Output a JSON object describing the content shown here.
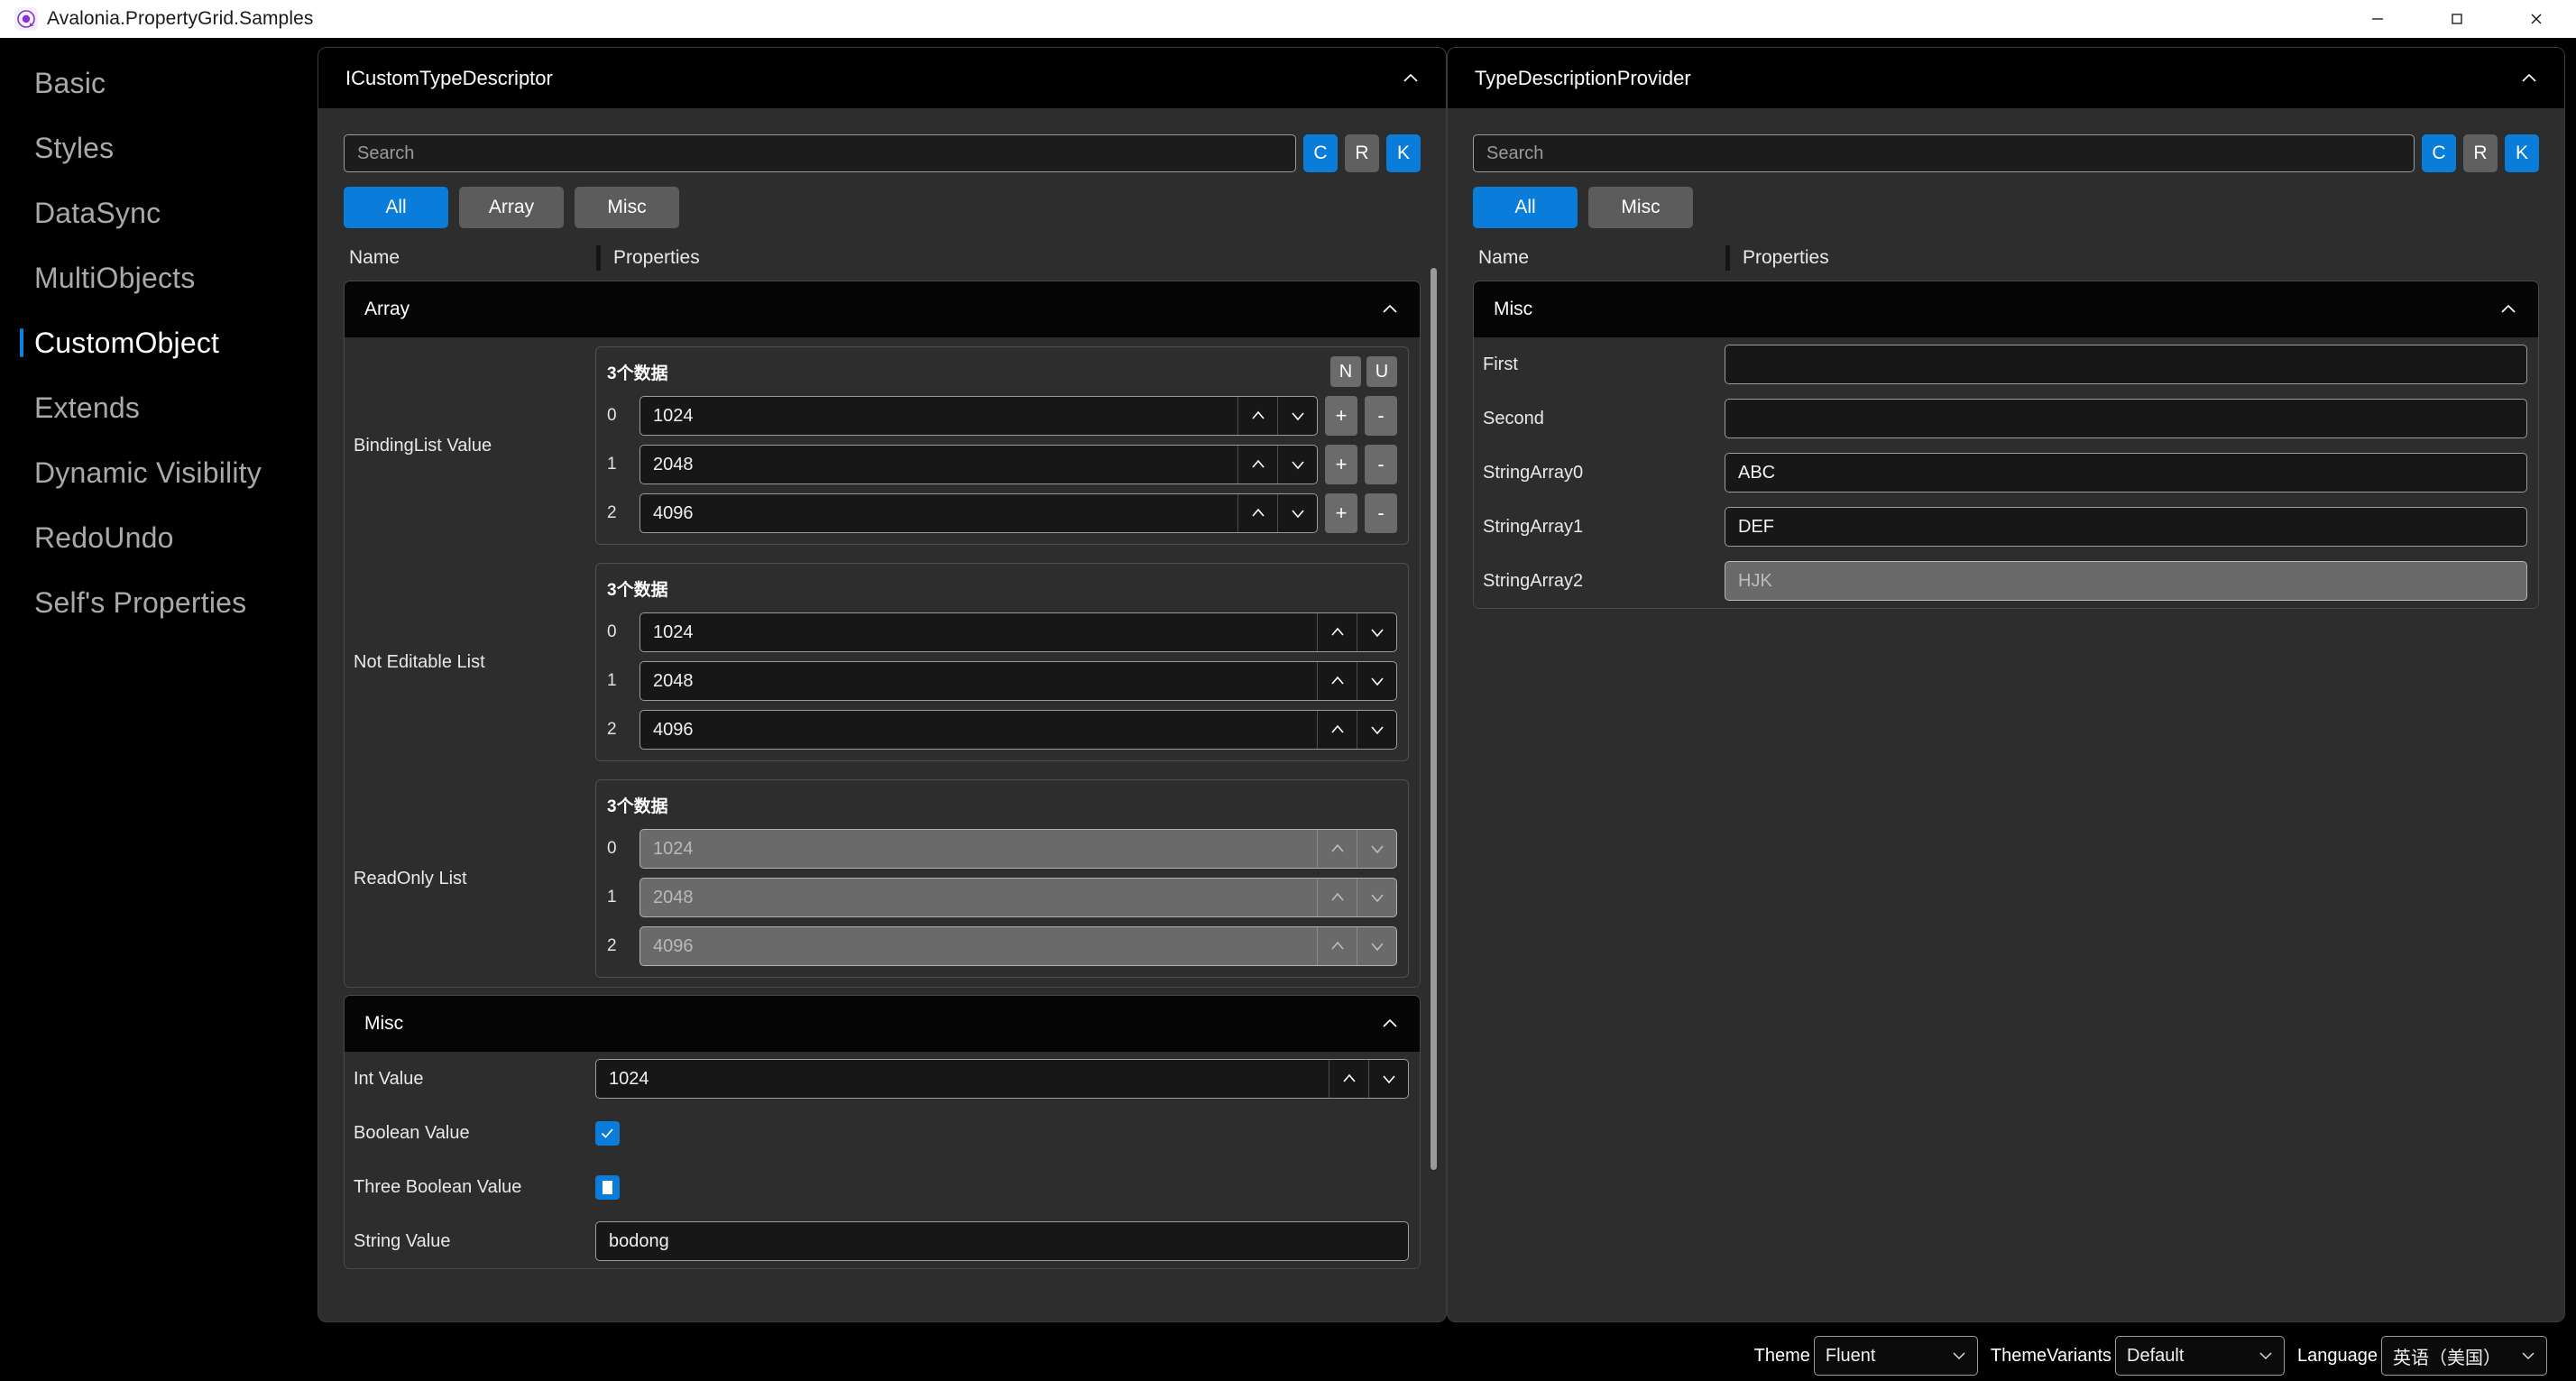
{
  "window": {
    "title": "Avalonia.PropertyGrid.Samples",
    "logo_icon": "avalonia-logo-icon",
    "minimize_icon": "minimize-icon",
    "maximize_icon": "maximize-icon",
    "close_icon": "close-icon"
  },
  "sidebar": {
    "items": [
      {
        "label": "Basic",
        "selected": false
      },
      {
        "label": "Styles",
        "selected": false
      },
      {
        "label": "DataSync",
        "selected": false
      },
      {
        "label": "MultiObjects",
        "selected": false
      },
      {
        "label": "CustomObject",
        "selected": true
      },
      {
        "label": "Extends",
        "selected": false
      },
      {
        "label": "Dynamic Visibility",
        "selected": false
      },
      {
        "label": "RedoUndo",
        "selected": false
      },
      {
        "label": "Self's Properties",
        "selected": false
      }
    ]
  },
  "colors": {
    "accent": "#0a7ddb",
    "panel_bg": "#2d2d2d",
    "header_bg": "#000000",
    "field_bg": "#171717",
    "disabled_bg": "#6a6a6a",
    "selected_indicator": "#0a84e0"
  },
  "left_panel": {
    "title": "ICustomTypeDescriptor",
    "collapse_icon": "chevron-up-icon",
    "search": {
      "placeholder": "Search",
      "value": "",
      "icon": "search-input"
    },
    "quick_buttons": [
      {
        "label": "C",
        "active": true
      },
      {
        "label": "R",
        "active": false
      },
      {
        "label": "K",
        "active": true
      }
    ],
    "filters": [
      {
        "label": "All",
        "active": true
      },
      {
        "label": "Array",
        "active": false
      },
      {
        "label": "Misc",
        "active": false
      }
    ],
    "columns": {
      "name": "Name",
      "properties": "Properties"
    },
    "categories": [
      {
        "name": "Array",
        "collapse_icon": "chevron-up-icon",
        "rows": [
          {
            "kind": "list",
            "label": "BindingList Value",
            "count_text": "3个数据",
            "show_nu": true,
            "nu_buttons": [
              "N",
              "U"
            ],
            "show_addremove": true,
            "add_label": "+",
            "remove_label": "-",
            "disabled": false,
            "items": [
              {
                "index": "0",
                "value": "1024"
              },
              {
                "index": "1",
                "value": "2048"
              },
              {
                "index": "2",
                "value": "4096"
              }
            ]
          },
          {
            "kind": "list",
            "label": "Not Editable List",
            "count_text": "3个数据",
            "show_nu": false,
            "nu_buttons": [],
            "show_addremove": false,
            "add_label": "+",
            "remove_label": "-",
            "disabled": false,
            "items": [
              {
                "index": "0",
                "value": "1024"
              },
              {
                "index": "1",
                "value": "2048"
              },
              {
                "index": "2",
                "value": "4096"
              }
            ]
          },
          {
            "kind": "list",
            "label": "ReadOnly List",
            "count_text": "3个数据",
            "show_nu": false,
            "nu_buttons": [],
            "show_addremove": false,
            "add_label": "+",
            "remove_label": "-",
            "disabled": true,
            "items": [
              {
                "index": "0",
                "value": "1024"
              },
              {
                "index": "1",
                "value": "2048"
              },
              {
                "index": "2",
                "value": "4096"
              }
            ]
          }
        ]
      },
      {
        "name": "Misc",
        "collapse_icon": "chevron-up-icon",
        "rows": [
          {
            "kind": "spin",
            "label": "Int Value",
            "value": "1024",
            "disabled": false
          },
          {
            "kind": "checkbox",
            "label": "Boolean Value",
            "state": "checked"
          },
          {
            "kind": "checkbox",
            "label": "Three Boolean Value",
            "state": "indeterminate"
          },
          {
            "kind": "text",
            "label": "String Value",
            "value": "bodong",
            "disabled": false
          }
        ]
      }
    ]
  },
  "right_panel": {
    "title": "TypeDescriptionProvider",
    "collapse_icon": "chevron-up-icon",
    "search": {
      "placeholder": "Search",
      "value": "",
      "icon": "search-input"
    },
    "quick_buttons": [
      {
        "label": "C",
        "active": true
      },
      {
        "label": "R",
        "active": false
      },
      {
        "label": "K",
        "active": true
      }
    ],
    "filters": [
      {
        "label": "All",
        "active": true
      },
      {
        "label": "Misc",
        "active": false
      }
    ],
    "columns": {
      "name": "Name",
      "properties": "Properties"
    },
    "categories": [
      {
        "name": "Misc",
        "collapse_icon": "chevron-up-icon",
        "rows": [
          {
            "kind": "text",
            "label": "First",
            "value": "",
            "disabled": false
          },
          {
            "kind": "text",
            "label": "Second",
            "value": "",
            "disabled": false
          },
          {
            "kind": "text",
            "label": "StringArray0",
            "value": "ABC",
            "disabled": false
          },
          {
            "kind": "text",
            "label": "StringArray1",
            "value": "DEF",
            "disabled": false
          },
          {
            "kind": "text",
            "label": "StringArray2",
            "value": "HJK",
            "disabled": true
          }
        ]
      }
    ]
  },
  "statusbar": {
    "theme": {
      "label": "Theme",
      "value": "Fluent",
      "chevron": "chevron-down-icon"
    },
    "theme_variants": {
      "label": "ThemeVariants",
      "value": "Default",
      "chevron": "chevron-down-icon"
    },
    "language": {
      "label": "Language",
      "value": "英语（美国）",
      "chevron": "chevron-down-icon"
    }
  }
}
